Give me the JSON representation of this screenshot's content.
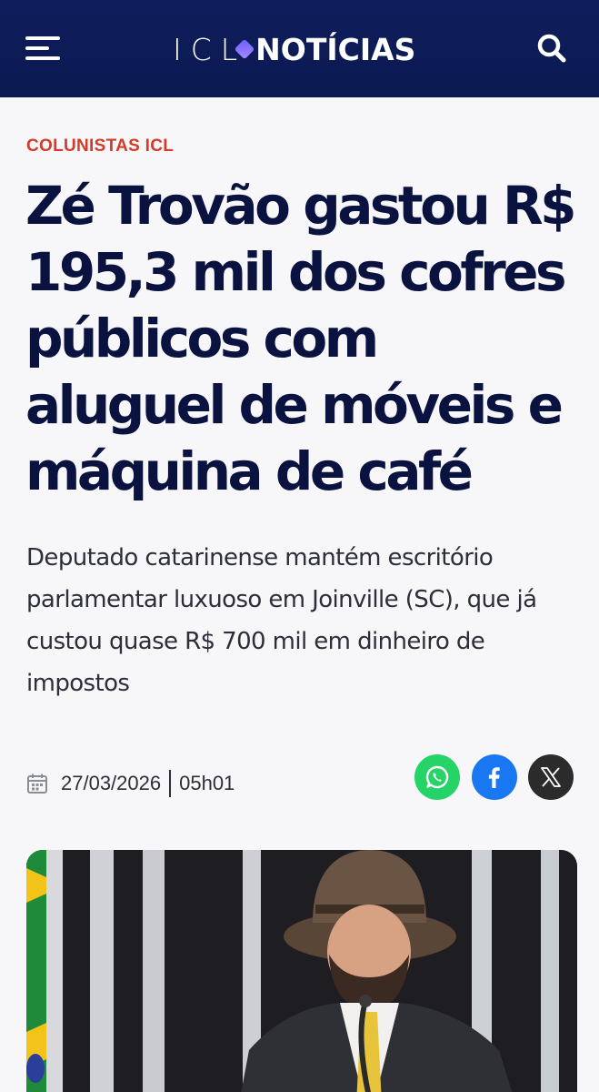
{
  "header": {
    "logo_prefix": "ICL",
    "logo_name": "NOTÍCIAS",
    "menu_icon": "hamburger-menu-icon",
    "search_icon": "search-icon",
    "background": "#0b1a52"
  },
  "article": {
    "category": "COLUNISTAS ICL",
    "title": "Zé Trovão gastou R$ 195,3 mil dos cofres públicos com aluguel de móveis e máquina de café",
    "subtitle": "Deputado catarinense mantém escritório parlamentar luxuoso em Joinville (SC), que já custou quase R$ 700 mil em dinheiro de impostos",
    "date": "27/03/2026",
    "time": "05h01"
  },
  "share": {
    "whatsapp_icon": "whatsapp-icon",
    "facebook_icon": "facebook-icon",
    "x_icon": "x-icon"
  },
  "colors": {
    "category": "#d33a2a",
    "title": "#0a1240",
    "whatsapp": "#25d366",
    "facebook": "#1a77f2",
    "x": "#2b2b2b"
  }
}
